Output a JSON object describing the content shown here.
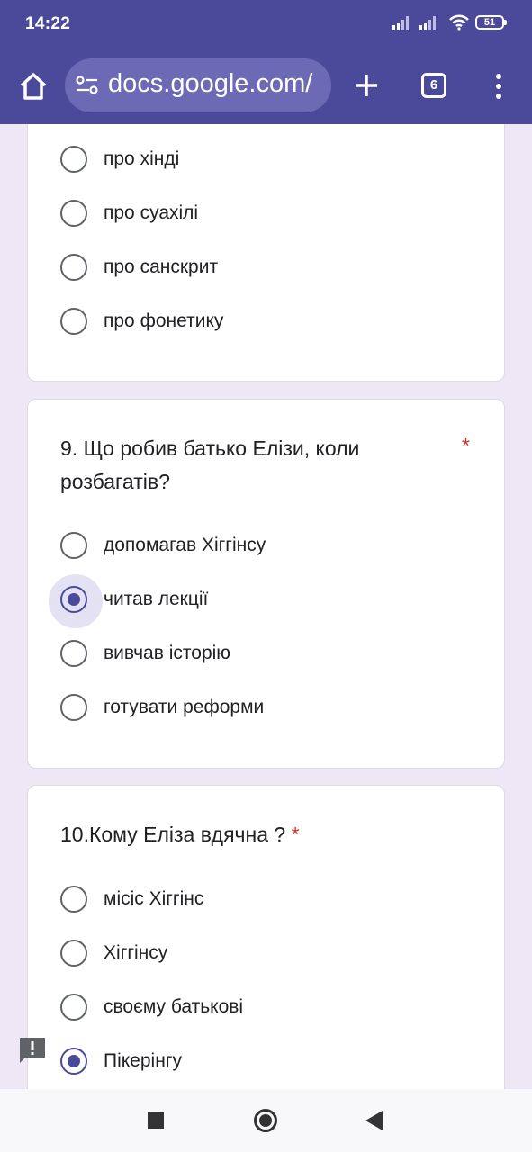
{
  "status_bar": {
    "time": "14:22",
    "battery": "51"
  },
  "browser": {
    "url": "docs.google.com/",
    "tab_count": "6"
  },
  "form": {
    "prev_question": {
      "options": [
        {
          "label": "про хінді",
          "selected": false
        },
        {
          "label": "про суахілі",
          "selected": false
        },
        {
          "label": "про санскрит",
          "selected": false
        },
        {
          "label": "про фонетику",
          "selected": false
        }
      ]
    },
    "q9": {
      "title": "9. Що робив батько Елізи, коли розбагатів?",
      "required_mark": "*",
      "options": [
        {
          "label": "допомагав Хіггінсу",
          "selected": false
        },
        {
          "label": "читав лекції",
          "selected": true
        },
        {
          "label": "вивчав історію",
          "selected": false
        },
        {
          "label": "готувати реформи",
          "selected": false
        }
      ]
    },
    "q10": {
      "title": "10.Кому Еліза вдячна ?",
      "required_mark": "*",
      "options": [
        {
          "label": "місіс Хіггінс",
          "selected": false
        },
        {
          "label": "Хіггінсу",
          "selected": false
        },
        {
          "label": "своєму батькові",
          "selected": false
        },
        {
          "label": "Пікерінгу",
          "selected": true
        }
      ]
    }
  },
  "colors": {
    "accent": "#4b4a9a",
    "background": "#ede7f6",
    "required": "#d93025"
  }
}
